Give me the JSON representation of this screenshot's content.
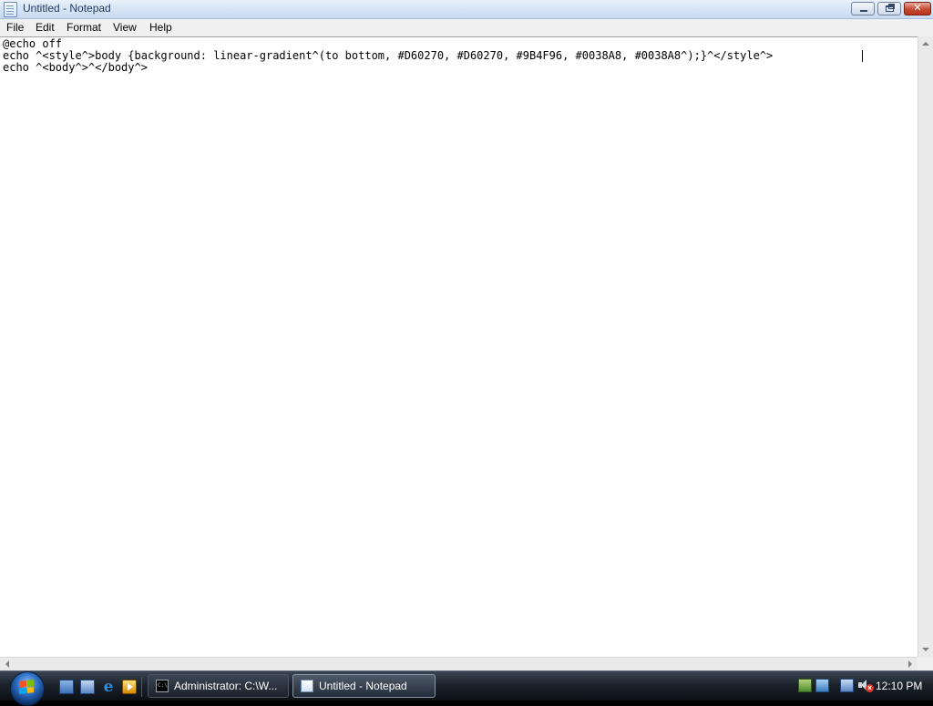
{
  "window": {
    "title": "Untitled - Notepad",
    "controls": {
      "minimize": "minimize",
      "maximize": "restore",
      "close": "✕"
    }
  },
  "menubar": {
    "items": [
      "File",
      "Edit",
      "Format",
      "View",
      "Help"
    ]
  },
  "editor": {
    "lines": [
      "@echo off",
      "echo ^<style^>body {background: linear-gradient^(to bottom, #D60270, #D60270, #9B4F96, #0038A8, #0038A8^);}^</style^> ",
      "echo ^<body^>^</body^>"
    ]
  },
  "taskbar": {
    "quick_launch": [
      "show-desktop-icon",
      "switch-windows-icon",
      "internet-explorer-icon",
      "media-player-icon"
    ],
    "tasks": [
      {
        "label": "Administrator: C:\\W...",
        "icon": "command-prompt-icon",
        "active": false
      },
      {
        "label": "Untitled - Notepad",
        "icon": "notepad-icon",
        "active": true
      }
    ],
    "tray": {
      "icons": [
        "network-icon",
        "network-status-icon",
        "display-icon",
        "volume-muted-icon"
      ],
      "clock": "12:10 PM"
    }
  }
}
